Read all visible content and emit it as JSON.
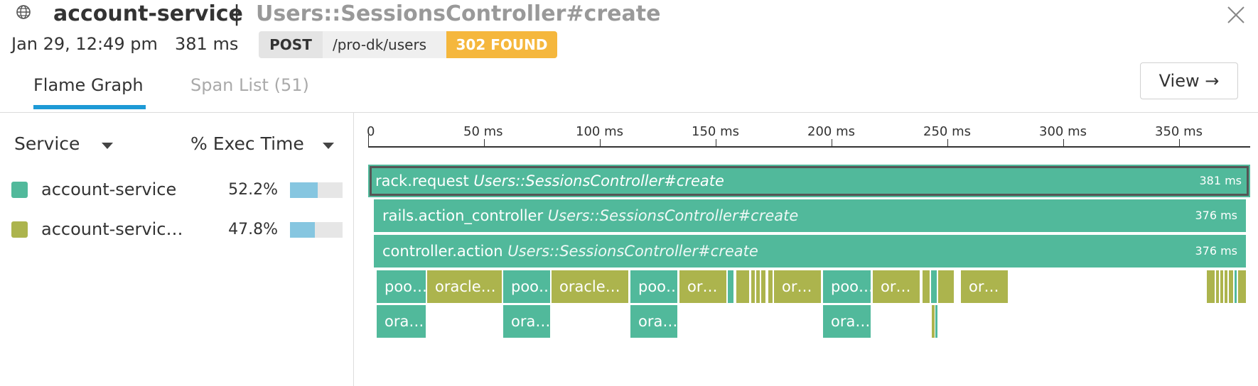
{
  "header": {
    "service": "account-service",
    "separator": "|",
    "resource": "Users::SessionsController#create",
    "date": "Jan 29, 12:49 pm",
    "duration": "381 ms",
    "method": "POST",
    "path": "/pro-dk/users",
    "status": "302 FOUND"
  },
  "tabs": {
    "flame": "Flame Graph",
    "spans": "Span List (51)",
    "view": "View →"
  },
  "legend": {
    "service_label": "Service",
    "exec_label": "% Exec Time",
    "rows": [
      {
        "name": "account-service",
        "pct": "52.2%",
        "fraction": 0.522,
        "color": "#51b99b"
      },
      {
        "name": "account-servic…",
        "pct": "47.8%",
        "fraction": 0.478,
        "color": "#acb44d"
      }
    ]
  },
  "timeline": {
    "ticks": [
      "0",
      "50 ms",
      "100 ms",
      "150 ms",
      "200 ms",
      "250 ms",
      "300 ms",
      "350 ms"
    ]
  },
  "spans": {
    "rack": {
      "name": "rack.request",
      "resource": "Users::SessionsController#create",
      "duration": "381 ms"
    },
    "action_controller": {
      "name": "rails.action_controller",
      "resource": "Users::SessionsController#create",
      "duration": "376 ms"
    },
    "controller_action": {
      "name": "controller.action",
      "resource": "Users::SessionsController#create",
      "duration": "376 ms"
    },
    "children": {
      "poo1": "poo…",
      "oracle1": "oracle…",
      "poo2": "poo…",
      "oracle2": "oracle…",
      "poo3": "poo…",
      "or1": "or…",
      "or2": "or…",
      "poo4": "poo…",
      "or3": "or…",
      "or4": "or…"
    },
    "grandchildren": {
      "ora1": "ora…",
      "ora2": "ora…",
      "ora3": "ora…",
      "ora4": "ora…"
    }
  },
  "colors": {
    "service_a": "#51b99b",
    "service_b": "#acb44d",
    "status": "#f5b73d",
    "tab_accent": "#1e9ad6"
  }
}
